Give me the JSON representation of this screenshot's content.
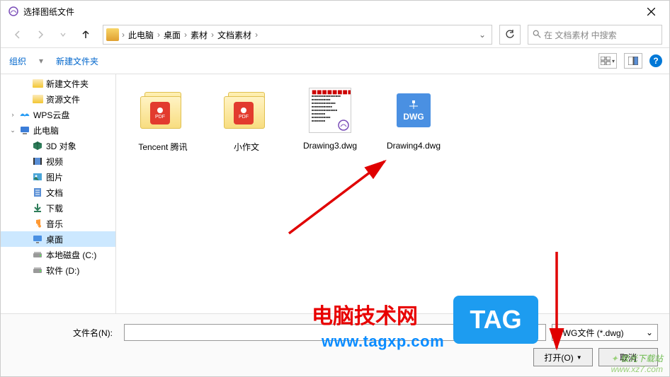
{
  "window": {
    "title": "选择图纸文件"
  },
  "nav": {
    "crumbs": [
      "此电脑",
      "桌面",
      "素材",
      "文档素材"
    ],
    "search_placeholder": "在 文档素材 中搜索"
  },
  "toolbar": {
    "organize": "组织",
    "newfolder": "新建文件夹"
  },
  "tree": {
    "items": [
      {
        "label": "新建文件夹",
        "type": "folder",
        "level": 1
      },
      {
        "label": "资源文件",
        "type": "folder",
        "level": 1
      },
      {
        "label": "WPS云盘",
        "type": "wps",
        "level": 0
      },
      {
        "label": "此电脑",
        "type": "pc",
        "level": 0
      },
      {
        "label": "3D 对象",
        "type": "3d",
        "level": 1
      },
      {
        "label": "视频",
        "type": "video",
        "level": 1
      },
      {
        "label": "图片",
        "type": "image",
        "level": 1
      },
      {
        "label": "文档",
        "type": "doc",
        "level": 1
      },
      {
        "label": "下载",
        "type": "download",
        "level": 1
      },
      {
        "label": "音乐",
        "type": "music",
        "level": 1
      },
      {
        "label": "桌面",
        "type": "desktop",
        "level": 1,
        "selected": true
      },
      {
        "label": "本地磁盘 (C:)",
        "type": "drive",
        "level": 1
      },
      {
        "label": "软件 (D:)",
        "type": "drive",
        "level": 1
      }
    ]
  },
  "files": [
    {
      "label": "Tencent 腾讯",
      "type": "pdf-folder"
    },
    {
      "label": "小作文",
      "type": "pdf-folder"
    },
    {
      "label": "Drawing3.dwg",
      "type": "doc"
    },
    {
      "label": "Drawing4.dwg",
      "type": "dwg"
    }
  ],
  "footer": {
    "filename_label": "文件名(N):",
    "filename_value": "",
    "filetype": "DWG文件 (*.dwg)",
    "open": "打开(O)",
    "cancel": "取消"
  },
  "watermarks": {
    "cn": "电脑技术网",
    "url": "www.tagxp.com",
    "tag": "TAG",
    "site2": "极光下载站",
    "site2url": "www.xz7.com"
  }
}
